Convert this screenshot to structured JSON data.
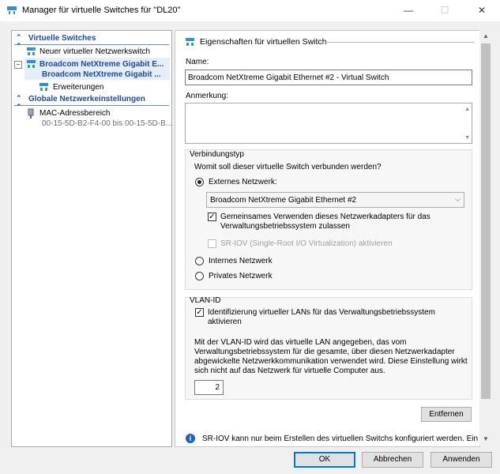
{
  "window": {
    "title": "Manager für virtuelle Switches für \"DL20\""
  },
  "tree": {
    "virtual_switches_header": "Virtuelle Switches",
    "new_switch": "Neuer virtueller Netzwerkswitch",
    "switch_name": "Broadcom NetXtreme Gigabit E...",
    "switch_subname": "Broadcom NetXtreme Gigabit ...",
    "extensions": "Erweiterungen",
    "global_header": "Globale Netzwerkeinstellungen",
    "mac_range": "MAC-Adressbereich",
    "mac_range_value": "00-15-5D-B2-F4-00 bis 00-15-5D-B..."
  },
  "props": {
    "section_title": "Eigenschaften für virtuellen Switch",
    "name_label": "Name:",
    "name_value": "Broadcom NetXtreme Gigabit Ethernet #2 - Virtual Switch",
    "notes_label": "Anmerkung:",
    "connection_group": "Verbindungstyp",
    "connection_question": "Womit soll dieser virtuelle Switch verbunden werden?",
    "external_label": "Externes Netzwerk:",
    "external_adapter": "Broadcom NetXtreme Gigabit Ethernet #2",
    "shared_line1": "Gemeinsames Verwenden dieses Netzwerkadapters für das",
    "shared_line2": "Verwaltungsbetriebssystem zulassen",
    "sriov_label": "SR-IOV (Single-Root I/O Virtualization) aktivieren",
    "internal_label": "Internes Netzwerk",
    "private_label": "Privates Netzwerk",
    "vlan_group": "VLAN-ID",
    "vlan_check_line1": "Identifizierung virtueller LANs für das Verwaltungsbetriebssystem",
    "vlan_check_line2": "aktivieren",
    "vlan_desc_line1": "Mit der VLAN-ID wird das virtuelle LAN angegeben, das vom",
    "vlan_desc_line2": "Verwaltungsbetriebssystem für die gesamte, über diesen Netzwerkadapter",
    "vlan_desc_line3": "abgewickelte Netzwerkkommunikation verwendet wird. Diese Einstellung wirkt",
    "vlan_desc_line4": "sich nicht auf das Netzwerk für virtuelle Computer aus.",
    "vlan_value": "2",
    "remove_button": "Entfernen",
    "info_text": "SR-IOV kann nur beim Erstellen des virtuellen Switchs konfiguriert werden. Ein"
  },
  "buttons": {
    "ok": "OK",
    "cancel": "Abbrechen",
    "apply": "Anwenden"
  },
  "state": {
    "shared_checked": true,
    "sriov_checked": false,
    "vlan_checked": true,
    "connection": "external"
  },
  "colors": {
    "accent": "#0078d7",
    "tree_header": "#1c4aa8",
    "selection": "#e5eef9",
    "info": "#1a63c4"
  }
}
